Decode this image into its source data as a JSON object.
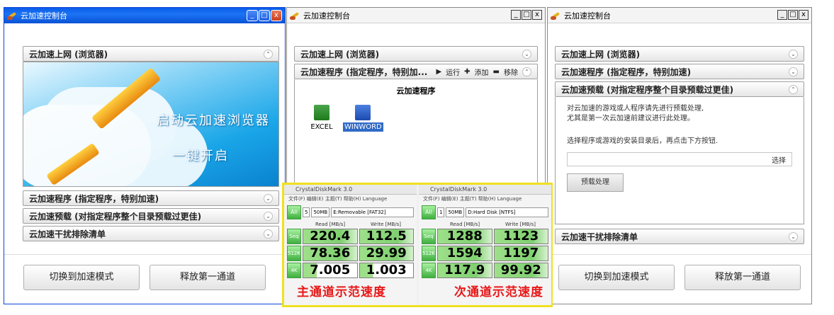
{
  "window_title": "云加速控制台",
  "window_controls": {
    "min": "_",
    "max": "□",
    "close": "x"
  },
  "bars": {
    "browser": "云加速上网 (浏览器)",
    "program": "云加速程序 (指定程序，特别加速)",
    "program_short": "云加速程序 (指定程序，特别加...",
    "preload": "云加速预载 (对指定程序整个目录预载过更佳)",
    "interference": "云加速干扰排除清单"
  },
  "banner": {
    "line1": "启动云加速浏览器",
    "line2": "一键开启"
  },
  "buttons": {
    "switch_mode": "切换到加速模式",
    "release": "释放第一通道"
  },
  "program_panel": {
    "heading": "云加速程序",
    "toolbar": {
      "run": "运行",
      "add": "添加",
      "remove": "移除"
    },
    "apps": [
      {
        "label": "EXCEL"
      },
      {
        "label": "WINWORD"
      }
    ]
  },
  "preload_panel": {
    "line1": "对云加速的游戏或人程序请先进行预载处理,",
    "line2": "尤其是第一次云加速前建议进行此处理。",
    "line3": "选择程序或游戏的安装目录后，再点击下方按钮.",
    "select": "选择",
    "process_button": "预载处理"
  },
  "cdm": {
    "title": "CrystalDiskMark 3.0",
    "menu": "文件(F)  编辑(E)  主题(T)  帮助(H)  Language",
    "left": {
      "count": "5",
      "size": "50MB",
      "drive": "E:Removable [FAT32]",
      "rows": [
        {
          "label": "Seq",
          "read": "220.4",
          "write": "112.5"
        },
        {
          "label": "512K",
          "read": "78.36",
          "write": "29.99"
        },
        {
          "label": "4K",
          "read": "7.005",
          "write": "1.003"
        }
      ]
    },
    "right": {
      "count": "1",
      "size": "50MB",
      "drive": "D:Hard Disk [NTFS]",
      "rows": [
        {
          "label": "Seq",
          "read": "1288",
          "write": "1123"
        },
        {
          "label": "512K",
          "read": "1594",
          "write": "1197"
        },
        {
          "label": "4K",
          "read": "117.9",
          "write": "99.92"
        }
      ]
    },
    "read_head": "Read [MB/s]",
    "write_head": "Write [MB/s]",
    "all": "All"
  },
  "highlights": {
    "main": "主通道示范速度",
    "second": "次通道示范速度"
  }
}
